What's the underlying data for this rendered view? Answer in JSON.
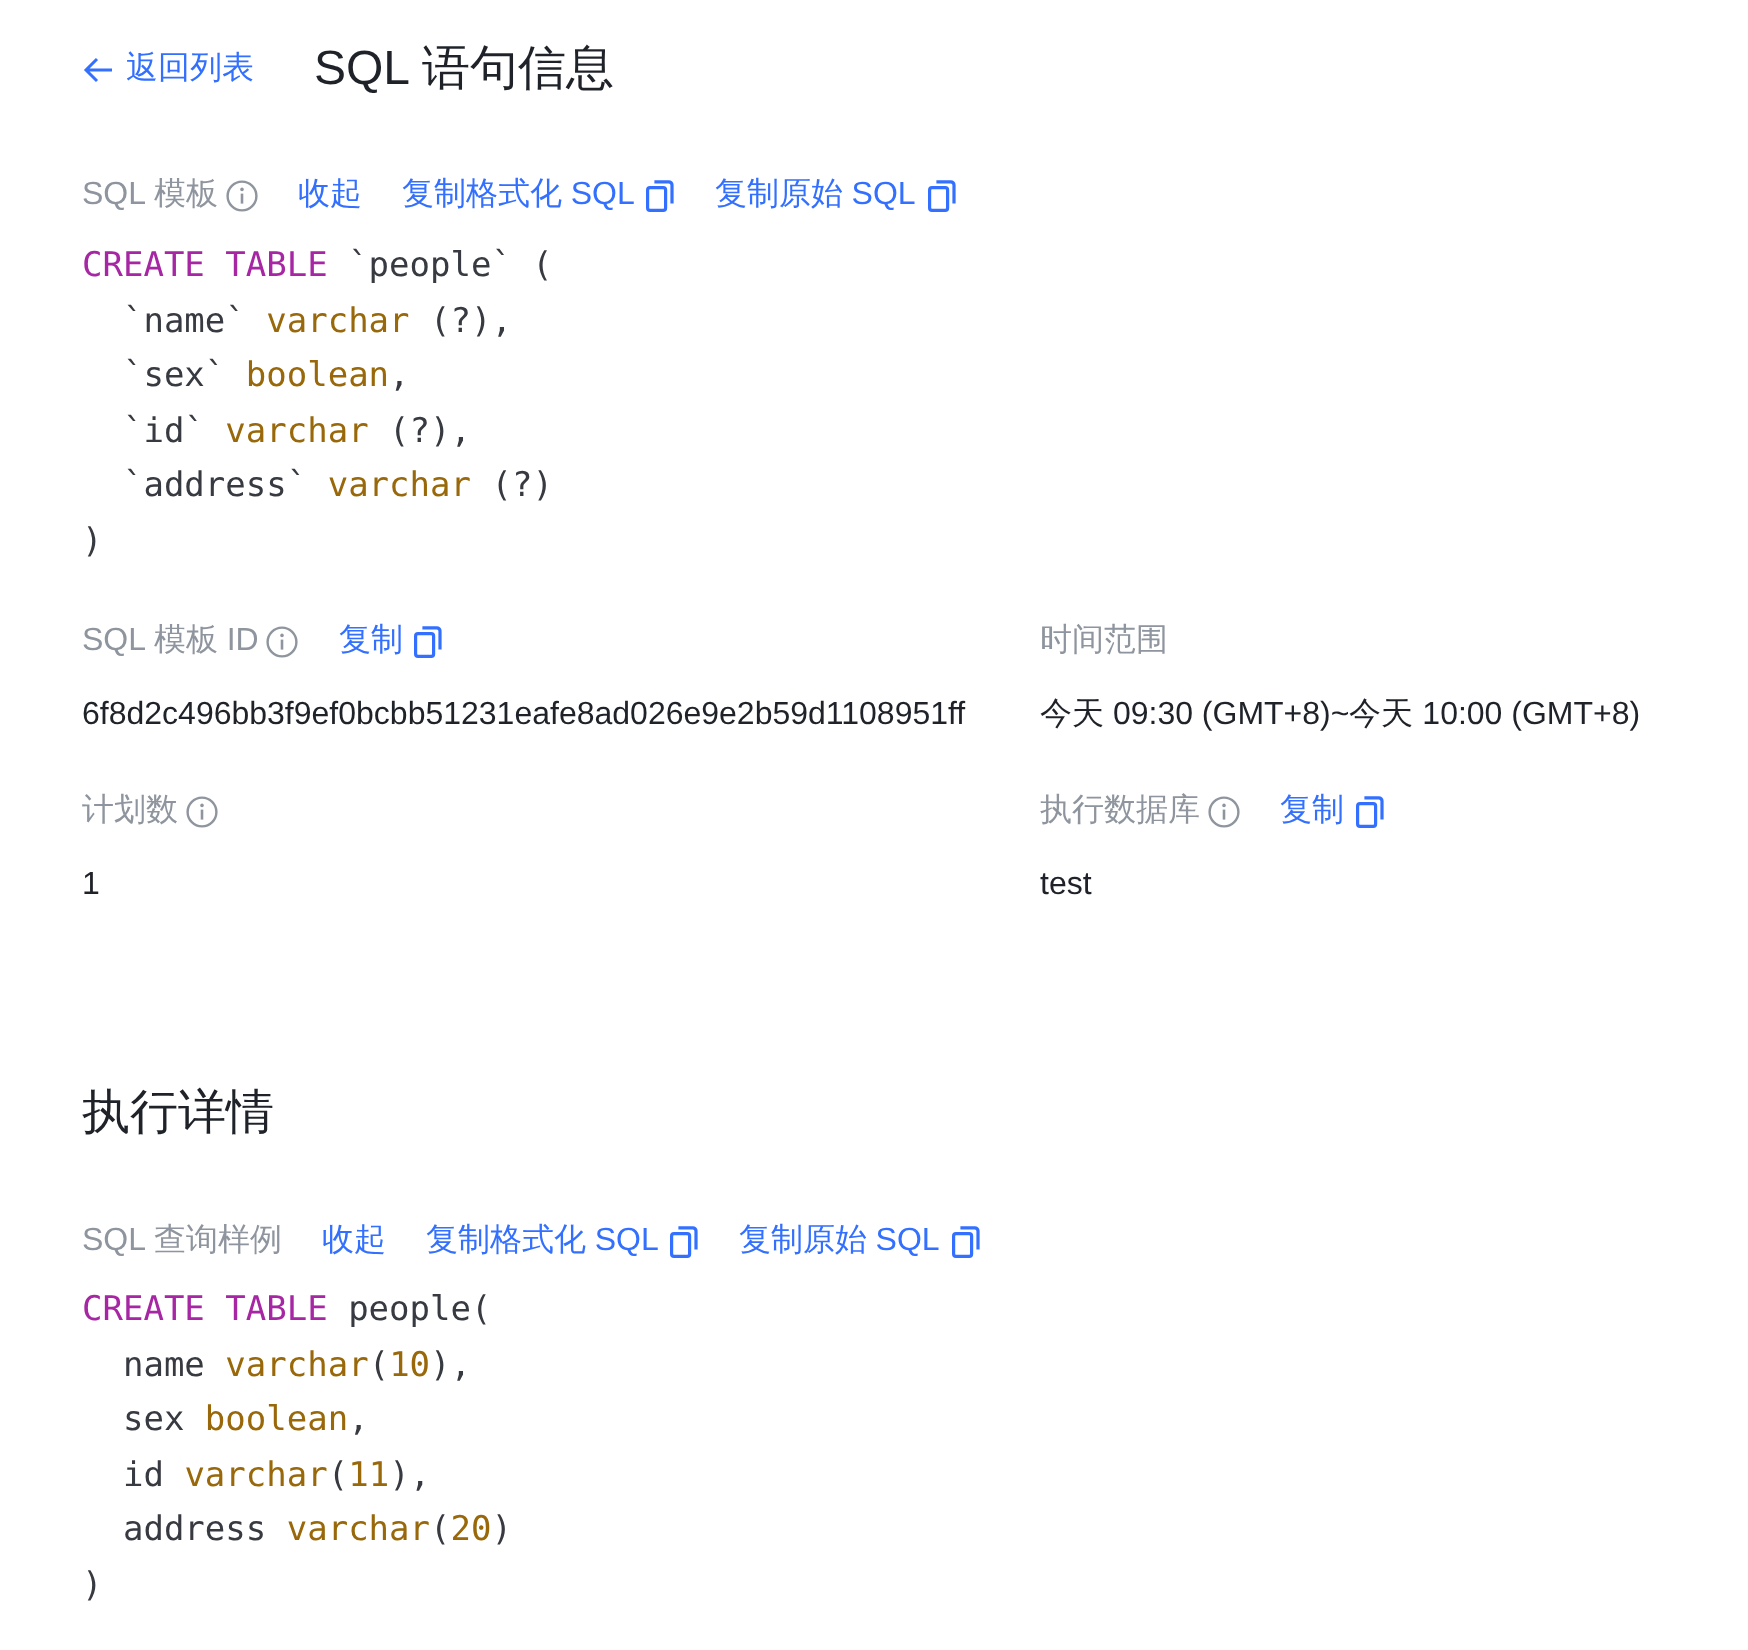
{
  "back_link": {
    "label": "返回列表"
  },
  "title": "SQL 语句信息",
  "template": {
    "label": "SQL 模板",
    "info": true,
    "actions": [
      {
        "kind": "toggle",
        "label": "收起"
      },
      {
        "kind": "copy",
        "label": "复制格式化 SQL"
      },
      {
        "kind": "copy",
        "label": "复制原始 SQL"
      }
    ],
    "code": [
      {
        "tokens": [
          {
            "kind": "keyword",
            "text": "CREATE TABLE"
          },
          {
            "kind": "plain",
            "text": " `people` ("
          }
        ],
        "children": [
          {
            "tokens": [
              {
                "kind": "plain",
                "text": "`name` "
              },
              {
                "kind": "type",
                "text": "varchar"
              },
              {
                "kind": "plain",
                "text": " (?),"
              }
            ]
          },
          {
            "tokens": [
              {
                "kind": "plain",
                "text": "`sex` "
              },
              {
                "kind": "type",
                "text": "boolean"
              },
              {
                "kind": "plain",
                "text": ","
              }
            ]
          },
          {
            "tokens": [
              {
                "kind": "plain",
                "text": "`id` "
              },
              {
                "kind": "type",
                "text": "varchar"
              },
              {
                "kind": "plain",
                "text": " (?),"
              }
            ]
          },
          {
            "tokens": [
              {
                "kind": "plain",
                "text": "`address` "
              },
              {
                "kind": "type",
                "text": "varchar"
              },
              {
                "kind": "plain",
                "text": " (?)"
              }
            ]
          }
        ]
      },
      {
        "tokens": [
          {
            "kind": "plain",
            "text": ")"
          }
        ]
      }
    ]
  },
  "fields": [
    {
      "label": "SQL 模板 ID",
      "info": true,
      "actions": [
        {
          "kind": "copy",
          "label": "复制"
        }
      ],
      "value": "6f8d2c496bb3f9ef0bcbb51231eafe8ad026e9e2b59d1108951ff"
    },
    {
      "label": "时间范围",
      "info": false,
      "value": "今天 09:30 (GMT+8)~今天 10:00 (GMT+8)"
    },
    {
      "label": "计划数",
      "info": true,
      "value": "1"
    },
    {
      "label": "执行数据库",
      "info": true,
      "actions": [
        {
          "kind": "copy",
          "label": "复制"
        }
      ],
      "value": "test"
    }
  ],
  "execution": {
    "heading": "执行详情",
    "sample": {
      "label": "SQL 查询样例",
      "info": false,
      "actions": [
        {
          "kind": "toggle",
          "label": "收起"
        },
        {
          "kind": "copy",
          "label": "复制格式化 SQL"
        },
        {
          "kind": "copy",
          "label": "复制原始 SQL"
        }
      ],
      "code": [
        {
          "tokens": [
            {
              "kind": "keyword",
              "text": "CREATE TABLE"
            },
            {
              "kind": "plain",
              "text": " people("
            }
          ],
          "children": [
            {
              "tokens": [
                {
                  "kind": "plain",
                  "text": "name "
                },
                {
                  "kind": "type",
                  "text": "varchar"
                },
                {
                  "kind": "plain",
                  "text": "("
                },
                {
                  "kind": "number",
                  "text": "10"
                },
                {
                  "kind": "plain",
                  "text": "),"
                }
              ]
            },
            {
              "tokens": [
                {
                  "kind": "plain",
                  "text": "sex "
                },
                {
                  "kind": "type",
                  "text": "boolean"
                },
                {
                  "kind": "plain",
                  "text": ","
                }
              ]
            },
            {
              "tokens": [
                {
                  "kind": "plain",
                  "text": "id "
                },
                {
                  "kind": "type",
                  "text": "varchar"
                },
                {
                  "kind": "plain",
                  "text": "("
                },
                {
                  "kind": "number",
                  "text": "11"
                },
                {
                  "kind": "plain",
                  "text": "),"
                }
              ]
            },
            {
              "tokens": [
                {
                  "kind": "plain",
                  "text": "address "
                },
                {
                  "kind": "type",
                  "text": "varchar"
                },
                {
                  "kind": "plain",
                  "text": "("
                },
                {
                  "kind": "number",
                  "text": "20"
                },
                {
                  "kind": "plain",
                  "text": ")"
                }
              ]
            }
          ]
        },
        {
          "tokens": [
            {
              "kind": "plain",
              "text": ")"
            }
          ]
        }
      ]
    }
  }
}
